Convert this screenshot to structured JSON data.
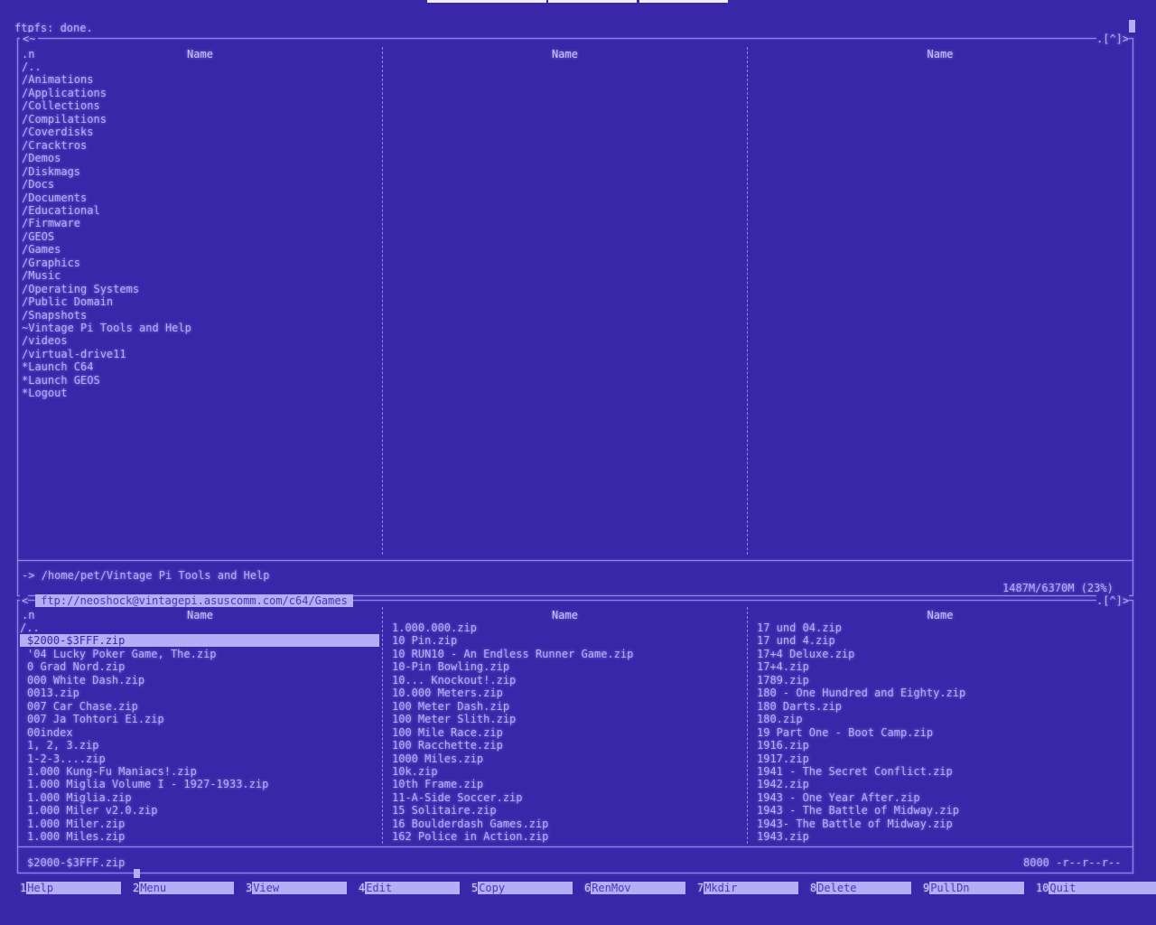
{
  "status_line": "ftpfs: done.",
  "top_panel": {
    "path": "~",
    "corner_indicator": ".[^]>",
    "header_n": ".n",
    "col_headers": [
      "Name",
      "Name",
      "Name"
    ],
    "columns": [
      [
        "/..",
        "/Animations",
        "/Applications",
        "/Collections",
        "/Compilations",
        "/Coverdisks",
        "/Cracktros",
        "/Demos",
        "/Diskmags",
        "/Docs",
        "/Documents",
        "/Educational",
        "/Firmware",
        "/GEOS",
        "/Games",
        "/Graphics",
        "/Music",
        "/Operating Systems",
        "/Public Domain",
        "/Snapshots",
        "~Vintage Pi Tools and Help",
        "/videos",
        "/virtual-drive11",
        "*Launch C64",
        "*Launch GEOS",
        "*Logout"
      ],
      [],
      []
    ],
    "info_line": "-> /home/pet/Vintage Pi Tools and Help",
    "disk_usage": "1487M/6370M (23%)"
  },
  "bottom_panel": {
    "path": "ftp://neoshock@vintagepi.asuscomm.com/c64/Games",
    "corner_indicator": ".[^]>",
    "header_n": ".n",
    "col_headers": [
      "Name",
      "Name",
      "Name"
    ],
    "columns": [
      [
        "/..",
        "$2000-$3FFF.zip",
        "'04 Lucky Poker Game, The.zip",
        "0 Grad Nord.zip",
        "000 White Dash.zip",
        "0013.zip",
        "007 Car Chase.zip",
        "007 Ja Tohtori Ei.zip",
        "00index",
        "1, 2, 3.zip",
        "1-2-3....zip",
        "1.000 Kung-Fu Maniacs!.zip",
        "1.000 Miglia Volume I - 1927-1933.zip",
        "1.000 Miglia.zip",
        "1.000 Miler v2.0.zip",
        "1.000 Miler.zip",
        "1.000 Miles.zip"
      ],
      [
        "1.000.000.zip",
        "10 Pin.zip",
        "10 RUN10 - An Endless Runner Game.zip",
        "10-Pin Bowling.zip",
        "10... Knockout!.zip",
        "10.000 Meters.zip",
        "100 Meter Dash.zip",
        "100 Meter Slith.zip",
        "100 Mile Race.zip",
        "100 Racchette.zip",
        "1000 Miles.zip",
        "10k.zip",
        "10th Frame.zip",
        "11-A-Side Soccer.zip",
        "15 Solitaire.zip",
        "16 Boulderdash Games.zip",
        "162 Police in Action.zip"
      ],
      [
        "17 und 04.zip",
        "17 und 4.zip",
        "17+4 Deluxe.zip",
        "17+4.zip",
        "1789.zip",
        "180 - One Hundred and Eighty.zip",
        "180 Darts.zip",
        "180.zip",
        "19 Part One - Boot Camp.zip",
        "1916.zip",
        "1917.zip",
        "1941 - The Secret Conflict.zip",
        "1942.zip",
        "1943 - One Year After.zip",
        "1943 - The Battle of Midway.zip",
        "1943- The Battle of Midway.zip",
        "1943.zip"
      ]
    ],
    "selected_file": "$2000-$3FFF.zip",
    "selected_info": "8000 -r--r--r--"
  },
  "function_keys": [
    {
      "num": "1",
      "label": "Help"
    },
    {
      "num": "2",
      "label": "Menu"
    },
    {
      "num": "3",
      "label": "View"
    },
    {
      "num": "4",
      "label": "Edit"
    },
    {
      "num": "5",
      "label": "Copy"
    },
    {
      "num": "6",
      "label": "RenMov"
    },
    {
      "num": "7",
      "label": "Mkdir"
    },
    {
      "num": "8",
      "label": "Delete"
    },
    {
      "num": "9",
      "label": "PullDn"
    },
    {
      "num": "10",
      "label": "Quit"
    }
  ],
  "colors": {
    "background": "#3a26a8",
    "text": "#b4aeff",
    "highlight": "#b3aef5"
  }
}
